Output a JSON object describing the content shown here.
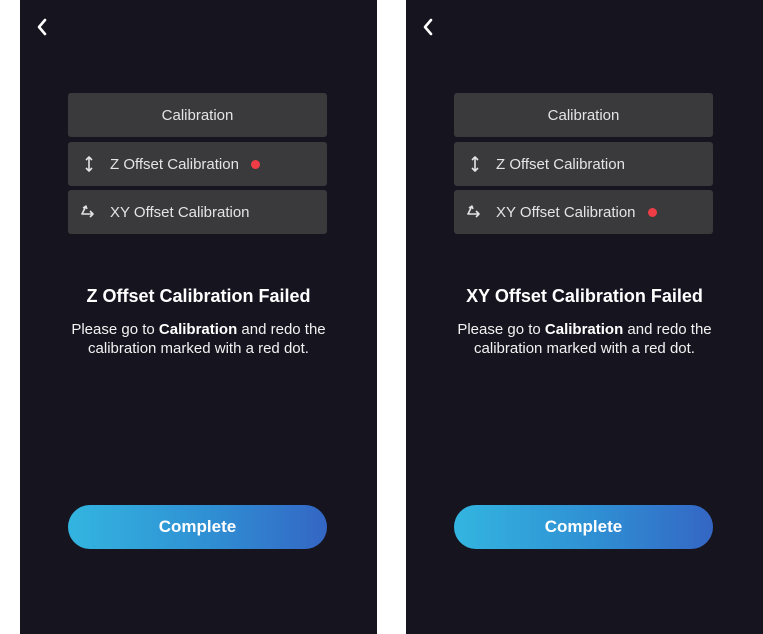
{
  "screens": [
    {
      "menu": {
        "header": "Calibration",
        "z_label": "Z Offset Calibration",
        "xy_label": "XY Offset Calibration",
        "z_marked": true,
        "xy_marked": false
      },
      "title": "Z Offset Calibration Failed",
      "message": {
        "prefix": "Please go to ",
        "bold": "Calibration",
        "suffix": " and redo the calibration marked with a red dot."
      },
      "complete_label": "Complete"
    },
    {
      "menu": {
        "header": "Calibration",
        "z_label": "Z Offset Calibration",
        "xy_label": "XY Offset Calibration",
        "z_marked": false,
        "xy_marked": true
      },
      "title": "XY Offset Calibration Failed",
      "message": {
        "prefix": "Please go to ",
        "bold": "Calibration",
        "suffix": " and redo the calibration marked with a red dot."
      },
      "complete_label": "Complete"
    }
  ],
  "icons": {
    "back": "chevron-left-icon",
    "z_offset": "vertical-arrows-icon",
    "xy_offset": "xy-axis-arrow-icon"
  },
  "colors": {
    "background": "#16151f",
    "menu_item": "#3a3a3d",
    "red_dot": "#ee3d45",
    "button_gradient_start": "#33b5e0",
    "button_gradient_end": "#3466c4"
  }
}
